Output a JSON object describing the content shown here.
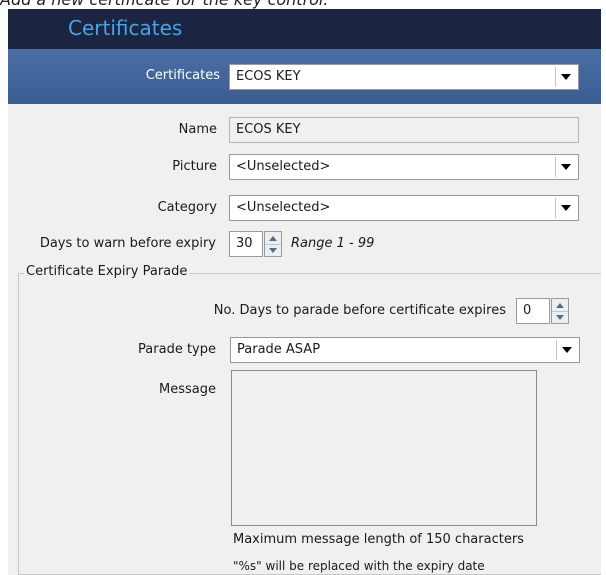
{
  "caption": "Add a new certificate for the key control:",
  "window": {
    "title": "Certificates"
  },
  "toolbar": {
    "certificates_label": "Certificates",
    "certificates_value": "ECOS KEY"
  },
  "form": {
    "name_label": "Name",
    "name_value": "ECOS KEY",
    "picture_label": "Picture",
    "picture_value": "<Unselected>",
    "category_label": "Category",
    "category_value": "<Unselected>",
    "days_warn_label": "Days to warn before expiry",
    "days_warn_value": "30",
    "days_warn_range": "Range 1 - 99"
  },
  "parade": {
    "legend": "Certificate Expiry Parade",
    "days_label": "No. Days to parade before certificate expires",
    "days_value": "0",
    "type_label": "Parade type",
    "type_value": "Parade ASAP",
    "message_label": "Message",
    "message_value": "",
    "max_length_note": "Maximum message length of 150 characters",
    "replace_note": "\"%s\" will be replaced with the expiry date"
  },
  "icons": {
    "dropdown": "chevron-down-icon",
    "spin_up": "spin-up-icon",
    "spin_down": "spin-down-icon"
  },
  "colors": {
    "title_bar": "#1b2440",
    "title_text": "#4aa3e8",
    "toolbar": "#4a6fa5"
  }
}
